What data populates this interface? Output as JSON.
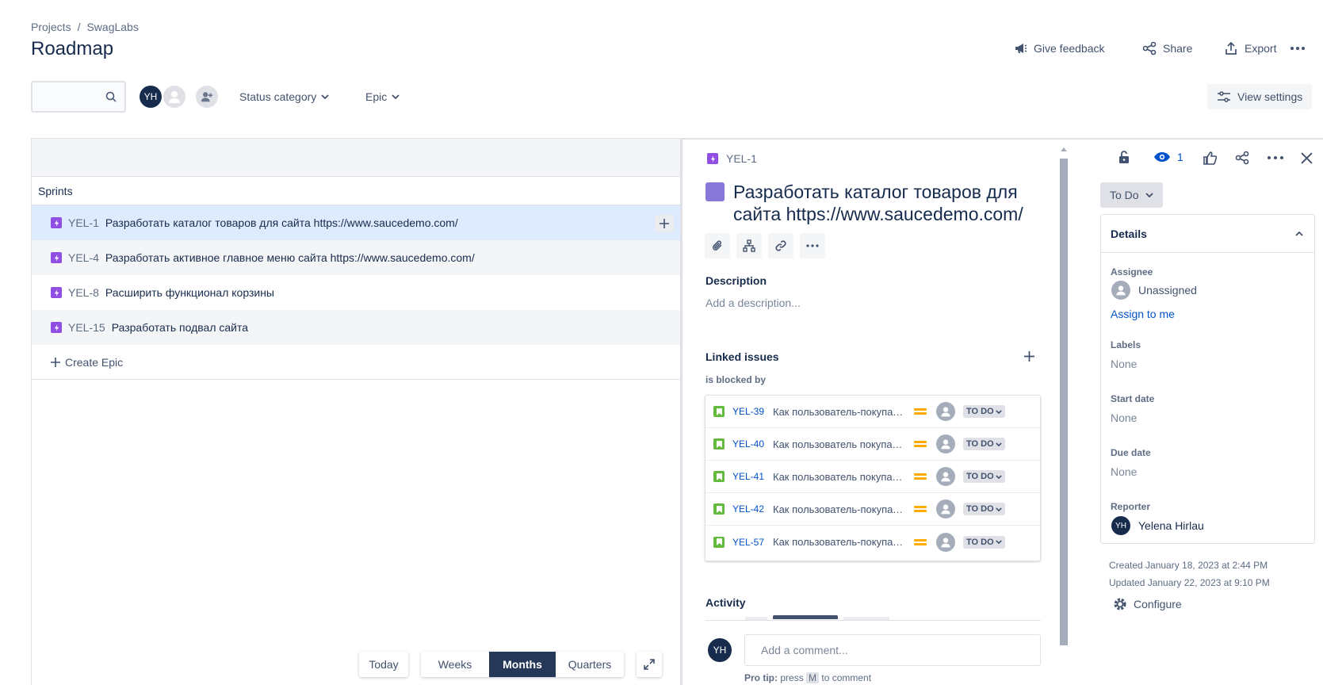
{
  "breadcrumb": {
    "projects": "Projects",
    "sep": "/",
    "project": "SwagLabs"
  },
  "page_title": "Roadmap",
  "header_actions": {
    "feedback": "Give feedback",
    "share": "Share",
    "export": "Export"
  },
  "toolbar": {
    "search_placeholder": "",
    "avatar_initials": "YH",
    "filter_status": "Status category",
    "filter_epic": "Epic",
    "view_settings": "View settings"
  },
  "roadmap": {
    "sprints_label": "Sprints",
    "epics": [
      {
        "key": "YEL-1",
        "summary": "Разработать каталог товаров для сайта https://www.saucedemo.com/"
      },
      {
        "key": "YEL-4",
        "summary": "Разработать активное главное меню сайта https://www.saucedemo.com/"
      },
      {
        "key": "YEL-8",
        "summary": "Расширить функционал корзины"
      },
      {
        "key": "YEL-15",
        "summary": "Разработать подвал сайта"
      }
    ],
    "create_epic": "Create Epic",
    "time": {
      "today": "Today",
      "weeks": "Weeks",
      "months": "Months",
      "quarters": "Quarters"
    }
  },
  "issue": {
    "key": "YEL-1",
    "title": "Разработать каталог товаров для сайта https://www.saucedemo.com/",
    "description_label": "Description",
    "description_placeholder": "Add a description...",
    "linked_label": "Linked issues",
    "blocked_by": "is blocked by",
    "linked": [
      {
        "key": "YEL-39",
        "summary": "Как пользователь-покупатель",
        "status": "TO DO"
      },
      {
        "key": "YEL-40",
        "summary": "Как пользователь покупатель",
        "status": "TO DO"
      },
      {
        "key": "YEL-41",
        "summary": "Как пользователь покупатель",
        "status": "TO DO"
      },
      {
        "key": "YEL-42",
        "summary": "Как пользователь-покупатель",
        "status": "TO DO"
      },
      {
        "key": "YEL-57",
        "summary": "Как пользователь-покупатель",
        "status": "TO DO"
      }
    ],
    "activity_label": "Activity",
    "comment_avatar": "YH",
    "comment_placeholder": "Add a comment...",
    "protip_prefix": "Pro tip:",
    "protip_press": "press",
    "protip_key": "M",
    "protip_suffix": "to comment",
    "watch_count": "1"
  },
  "sidebar": {
    "status": "To Do",
    "details_label": "Details",
    "assignee_label": "Assignee",
    "assignee_value": "Unassigned",
    "assign_to_me": "Assign to me",
    "labels_label": "Labels",
    "labels_value": "None",
    "start_label": "Start date",
    "start_value": "None",
    "due_label": "Due date",
    "due_value": "None",
    "reporter_label": "Reporter",
    "reporter_initials": "YH",
    "reporter_name": "Yelena Hirlau",
    "created": "Created January 18, 2023 at 2:44 PM",
    "updated": "Updated January 22, 2023 at 9:10 PM",
    "configure": "Configure"
  },
  "colors": {
    "epic": "#904ee2",
    "story": "#63ba3c",
    "selected_row": "#deebff",
    "active_time": "#253858",
    "link": "#0052cc",
    "priority": "#ffab00"
  }
}
